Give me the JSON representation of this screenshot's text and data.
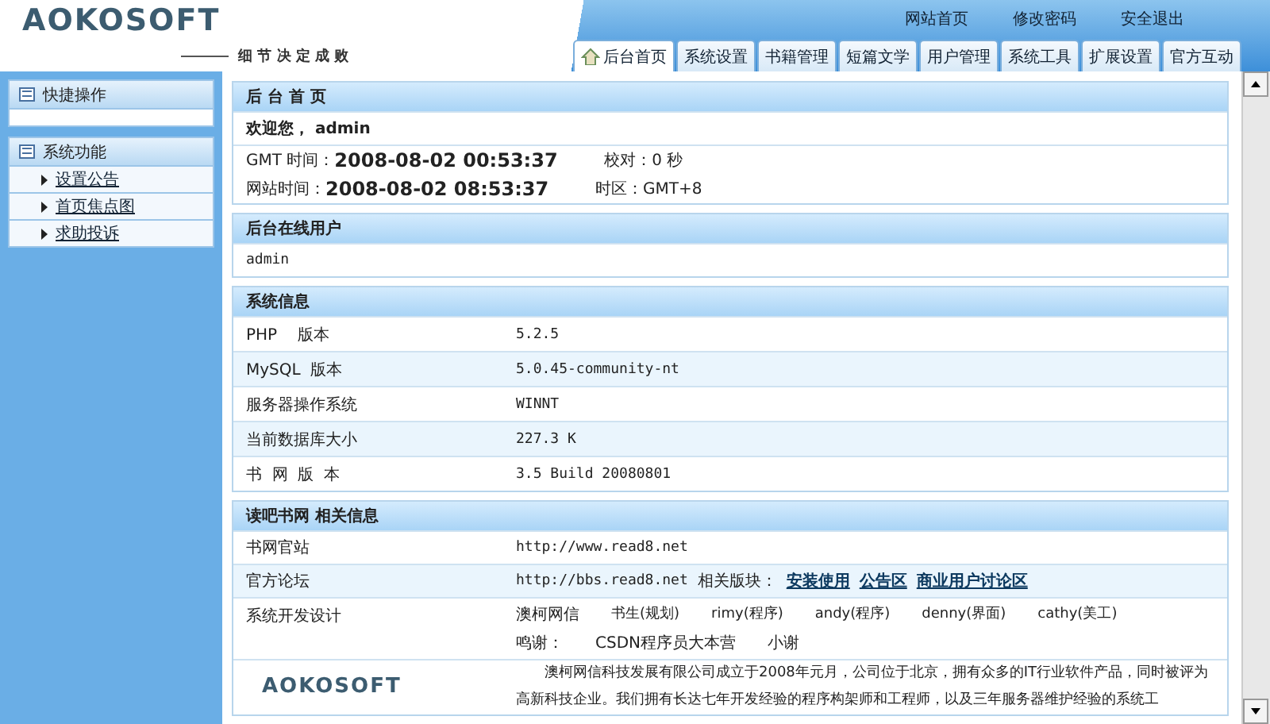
{
  "header": {
    "logo": "AOKOSOFT",
    "slogan": "细 节 决 定 成 败",
    "top_links": [
      "网站首页",
      "修改密码",
      "安全退出"
    ],
    "tabs": [
      {
        "label": "后台首页",
        "selected": true
      },
      {
        "label": "系统设置",
        "selected": false
      },
      {
        "label": "书籍管理",
        "selected": false
      },
      {
        "label": "短篇文学",
        "selected": false
      },
      {
        "label": "用户管理",
        "selected": false
      },
      {
        "label": "系统工具",
        "selected": false
      },
      {
        "label": "扩展设置",
        "selected": false
      },
      {
        "label": "官方互动",
        "selected": false
      }
    ]
  },
  "sidebar": {
    "sections": [
      {
        "title": "快捷操作"
      },
      {
        "title": "系统功能",
        "items": [
          "设置公告",
          "首页焦点图",
          "求助投诉"
        ]
      }
    ]
  },
  "home_panel": {
    "title": "后 台 首 页",
    "welcome": "欢迎您， admin",
    "rows": [
      {
        "label": "GMT 时间：",
        "time": "2008-08-02 00:53:37",
        "extra_label": "校对：",
        "extra_value": "0 秒"
      },
      {
        "label": "网站时间：",
        "time": "2008-08-02 08:53:37",
        "extra_label": "时区：",
        "extra_value": "GMT+8"
      }
    ]
  },
  "online_panel": {
    "title": "后台在线用户",
    "users": "admin"
  },
  "system_panel": {
    "title": "系统信息",
    "rows": [
      {
        "label": "PHP    版本",
        "value": "5.2.5"
      },
      {
        "label": "MySQL  版本",
        "value": "5.0.45-community-nt"
      },
      {
        "label": "服务器操作系统",
        "value": "WINNT"
      },
      {
        "label": "当前数据库大小",
        "value": "227.3 K"
      },
      {
        "label": "书  网  版  本",
        "value": "3.5 Build 20080801"
      }
    ]
  },
  "about_panel": {
    "title": "读吧书网 相关信息",
    "site": {
      "label": "书网官站",
      "url": "http://www.read8.net"
    },
    "forum": {
      "label": "官方论坛",
      "url": "http://bbs.read8.net",
      "sections_label": "相关版块：",
      "sections": [
        "安装使用",
        "公告区",
        "商业用户讨论区"
      ]
    },
    "team": {
      "label": "系统开发设计",
      "company": "澳柯网信",
      "members": [
        "书生(规划)",
        "rimy(程序)",
        "andy(程序)",
        "denny(界面)",
        "cathy(美工)"
      ],
      "thanks_label": "鸣谢：",
      "thanks": [
        "CSDN程序员大本营",
        "小谢"
      ]
    },
    "company": {
      "logo": "AOKOSOFT",
      "text": "澳柯网信科技发展有限公司成立于2008年元月，公司位于北京，拥有众多的IT行业软件产品，同时被评为高新科技企业。我们拥有长达七年开发经验的程序构架师和工程师，以及三年服务器维护经验的系统工"
    }
  }
}
